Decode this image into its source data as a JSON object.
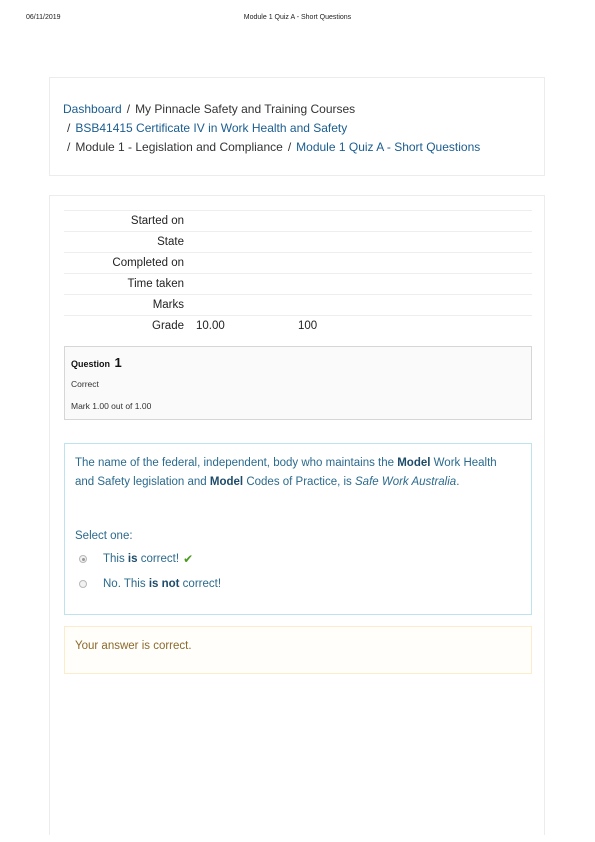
{
  "print_header": {
    "date": "06/11/2019",
    "title": "Module 1 Quiz A - Short Questions"
  },
  "breadcrumb": {
    "dashboard": "Dashboard",
    "my_courses": "My Pinnacle Safety and Training Courses",
    "course": "BSB41415 Certificate IV in Work Health and Safety",
    "section": "Module 1 - Legislation and Compliance",
    "quiz": "Module 1 Quiz A - Short Questions",
    "separator": "/"
  },
  "summary": {
    "rows": [
      {
        "label": "Started on",
        "value": ""
      },
      {
        "label": "State",
        "value": ""
      },
      {
        "label": "Completed on",
        "value": ""
      },
      {
        "label": "Time taken",
        "value": ""
      },
      {
        "label": "Marks",
        "value": ""
      },
      {
        "label": "Grade",
        "value": "10.00",
        "value2": "100"
      }
    ]
  },
  "question_info": {
    "prefix": "Question",
    "number": "1",
    "state": "Correct",
    "mark": "Mark 1.00 out of 1.00"
  },
  "question": {
    "text_1": "The name of the federal, independent, body who maintains the ",
    "bold_1": "Model",
    "text_2": " Work Health and Safety legislation and ",
    "bold_2": "Model",
    "text_3": " Codes of Practice, is ",
    "italic": "Safe Work Australia",
    "text_4": ".",
    "select_label": "Select one:",
    "options": [
      {
        "pre": "This ",
        "bold": "is",
        "post": " correct!",
        "checked": true
      },
      {
        "pre": "No. This ",
        "bold": "is not",
        "post": " correct!",
        "checked": false
      }
    ],
    "tick_icon": "check-icon"
  },
  "feedback": {
    "text": "Your answer is correct."
  },
  "colors": {
    "link": "#1b5d8f",
    "question_text": "#2b6a8d",
    "feedback_text": "#8b6a2c",
    "tick": "#4a9b1c"
  }
}
